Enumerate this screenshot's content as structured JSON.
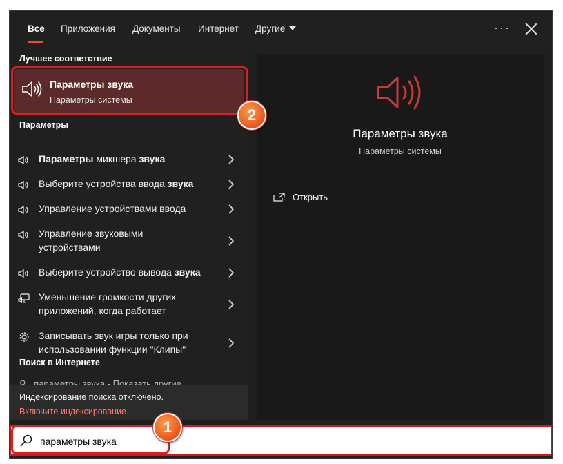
{
  "tabs": [
    "Все",
    "Приложения",
    "Документы",
    "Интернет",
    "Другие"
  ],
  "more_label": "···",
  "left": {
    "best_match_heading": "Лучшее соответствие",
    "best_match": {
      "title": "Параметры звука",
      "subtitle": "Параметры системы"
    },
    "settings_heading": "Параметры",
    "items": [
      {
        "icon": "speaker-icon",
        "label": "Параметры микшера звука"
      },
      {
        "icon": "speaker-icon",
        "label": "Выберите устройства ввода звука"
      },
      {
        "icon": "speaker-icon",
        "label": "Управление устройствами ввода"
      },
      {
        "icon": "speaker-icon",
        "label": "Управление звуковыми устройствами"
      },
      {
        "icon": "speaker-icon",
        "label": "Выберите устройство вывода звука"
      },
      {
        "icon": "monitor-speaker-icon",
        "label": "Уменьшение громкости других приложений, когда работает"
      },
      {
        "icon": "gear-icon",
        "label": "Записывать звук игры только при использовании функции \"Клипы\""
      }
    ],
    "web_heading": "Поиск в Интернете",
    "web_item": "параметры звука - Показать другие",
    "indexing_text": "Индексирование поиска отключено.",
    "indexing_link": "Включите индексирование."
  },
  "right": {
    "title": "Параметры звука",
    "subtitle": "Параметры системы",
    "open_label": "Открыть"
  },
  "search": {
    "value": "параметры звука"
  },
  "annotations": {
    "badge1": "1",
    "badge2": "2"
  },
  "colors": {
    "accent": "#e74c3c",
    "highlight": "#5c2a2a",
    "annotation": "#d91f1f",
    "link": "#ff7b6b"
  }
}
